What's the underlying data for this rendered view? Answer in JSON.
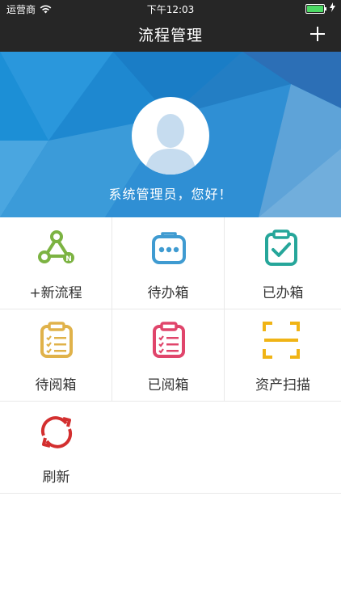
{
  "status_bar": {
    "carrier": "运营商",
    "time": "下午12:03"
  },
  "nav": {
    "title": "流程管理",
    "add_icon": "plus-icon"
  },
  "banner": {
    "greeting": "系统管理员，您好！",
    "avatar_icon": "user-silhouette-icon"
  },
  "menu": [
    {
      "label": "+新流程",
      "icon": "workflow-nodes-icon",
      "color": "#7cb342"
    },
    {
      "label": "待办箱",
      "icon": "pending-box-icon",
      "color": "#3f9bd1"
    },
    {
      "label": "已办箱",
      "icon": "done-clipboard-icon",
      "color": "#26a69a"
    },
    {
      "label": "待阅箱",
      "icon": "to-read-clipboard-icon",
      "color": "#e0b24a"
    },
    {
      "label": "已阅箱",
      "icon": "read-clipboard-icon",
      "color": "#e0456b"
    },
    {
      "label": "资产扫描",
      "icon": "scan-icon",
      "color": "#f0b416"
    },
    {
      "label": "刷新",
      "icon": "refresh-icon",
      "color": "#d32f2f"
    }
  ]
}
